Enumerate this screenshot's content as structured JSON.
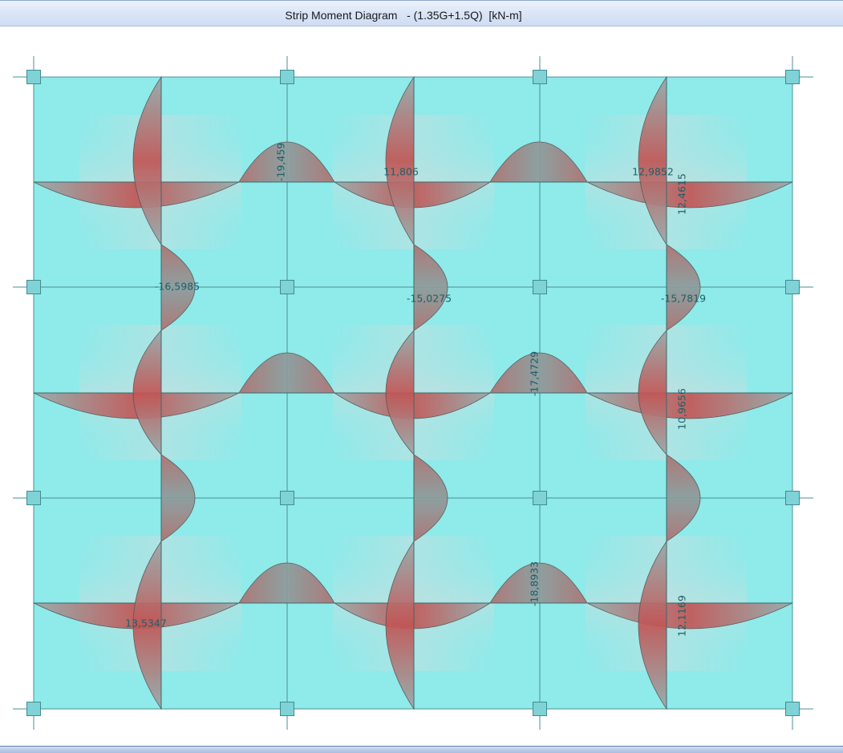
{
  "window": {
    "title": "Strip Moment Diagram   - (1.35G+1.5Q)  [kN-m]"
  },
  "colors": {
    "slab": "#8feaea",
    "slab_center": "#c9dcdc",
    "hog_moment": "#9c9c9c",
    "sag_moment": "#c55a5a",
    "label": "#1f5f66",
    "grid": "#4d8f94"
  },
  "moment_labels": [
    {
      "text": "-19,459",
      "orientation": "vertical"
    },
    {
      "text": "11,806",
      "orientation": "horizontal"
    },
    {
      "text": "12,9852",
      "orientation": "horizontal"
    },
    {
      "text": "12,4615",
      "orientation": "vertical"
    },
    {
      "text": "-16,5985",
      "orientation": "horizontal"
    },
    {
      "text": "-15,0275",
      "orientation": "horizontal"
    },
    {
      "text": "-15,7819",
      "orientation": "horizontal"
    },
    {
      "text": "-17,4729",
      "orientation": "vertical"
    },
    {
      "text": "10,9656",
      "orientation": "vertical"
    },
    {
      "text": "-18,8933",
      "orientation": "vertical"
    },
    {
      "text": "13,5347",
      "orientation": "horizontal"
    },
    {
      "text": "12,1169",
      "orientation": "vertical"
    }
  ]
}
